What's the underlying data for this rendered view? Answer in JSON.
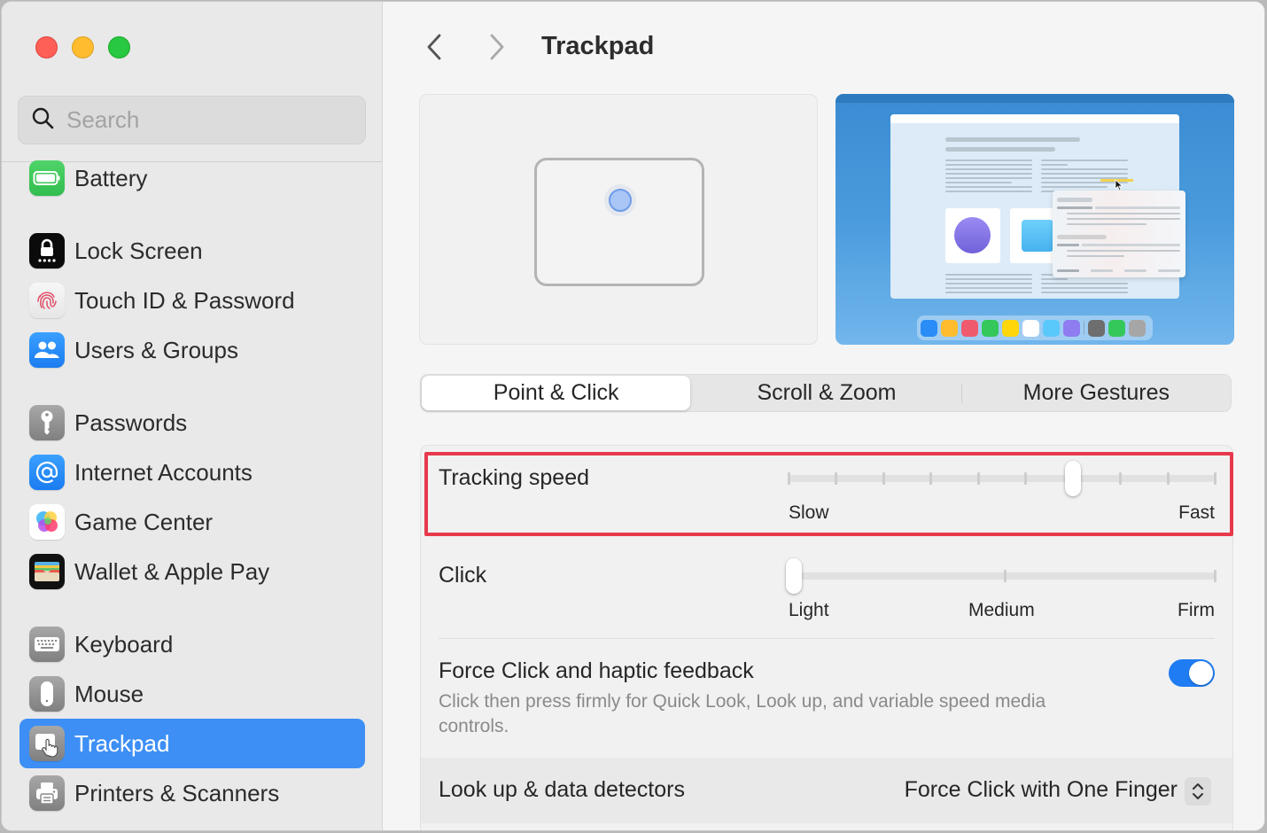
{
  "window": {
    "traffic_lights": [
      "close",
      "minimize",
      "zoom"
    ]
  },
  "sidebar": {
    "search": {
      "placeholder": "Search",
      "value": ""
    },
    "items": [
      {
        "id": "battery",
        "label": "Battery",
        "icon": "battery-icon",
        "active": false
      },
      {
        "id": "lock-screen",
        "label": "Lock Screen",
        "icon": "lock-screen-icon",
        "active": false
      },
      {
        "id": "touch-id",
        "label": "Touch ID & Password",
        "icon": "fingerprint-icon",
        "active": false
      },
      {
        "id": "users-groups",
        "label": "Users & Groups",
        "icon": "users-icon",
        "active": false
      },
      {
        "id": "passwords",
        "label": "Passwords",
        "icon": "key-icon",
        "active": false
      },
      {
        "id": "internet-accounts",
        "label": "Internet Accounts",
        "icon": "at-sign-icon",
        "active": false
      },
      {
        "id": "game-center",
        "label": "Game Center",
        "icon": "game-center-icon",
        "active": false
      },
      {
        "id": "wallet",
        "label": "Wallet & Apple Pay",
        "icon": "wallet-icon",
        "active": false
      },
      {
        "id": "keyboard",
        "label": "Keyboard",
        "icon": "keyboard-icon",
        "active": false
      },
      {
        "id": "mouse",
        "label": "Mouse",
        "icon": "mouse-icon",
        "active": false
      },
      {
        "id": "trackpad",
        "label": "Trackpad",
        "icon": "trackpad-icon",
        "active": true
      },
      {
        "id": "printers",
        "label": "Printers & Scanners",
        "icon": "printer-icon",
        "active": false
      }
    ]
  },
  "header": {
    "title": "Trackpad",
    "back_icon": "chevron-left-icon",
    "forward_icon": "chevron-right-icon"
  },
  "tabs": [
    {
      "label": "Point & Click",
      "active": true
    },
    {
      "label": "Scroll & Zoom",
      "active": false
    },
    {
      "label": "More Gestures",
      "active": false
    }
  ],
  "settings": {
    "tracking_speed": {
      "label": "Tracking speed",
      "min_label": "Slow",
      "max_label": "Fast",
      "steps": 10,
      "value_index": 6,
      "highlighted": true
    },
    "click": {
      "label": "Click",
      "labels": [
        "Light",
        "Medium",
        "Firm"
      ],
      "steps": 3,
      "value_index": 0
    },
    "force_click": {
      "label": "Force Click and haptic feedback",
      "description": "Click then press firmly for Quick Look, Look up, and variable speed media controls.",
      "enabled": true
    },
    "lookup": {
      "label": "Look up & data detectors",
      "value": "Force Click with One Finger"
    }
  },
  "colors": {
    "accent": "#3d8ff5",
    "toggle_on": "#1f7cf2",
    "highlight": "#e8394c",
    "dock": [
      "#2a8cf7",
      "#febc2e",
      "#f05a6e",
      "#34c759",
      "#ffd60a",
      "#ffffff",
      "#5ac8fa",
      "#8e7cf0",
      "sep",
      "#6e6e6e",
      "#34c759",
      "#a6a6a6"
    ]
  }
}
